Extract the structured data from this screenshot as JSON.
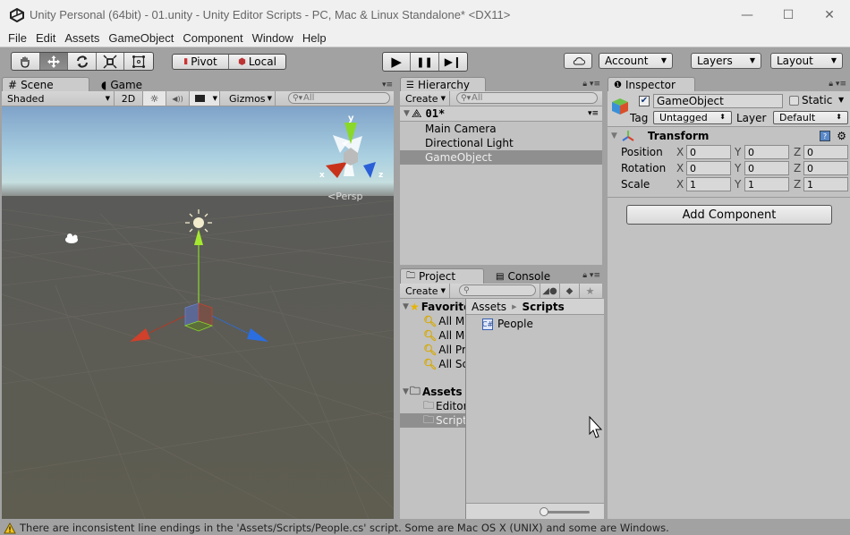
{
  "window": {
    "title": "Unity Personal (64bit) - 01.unity - Unity Editor Scripts - PC, Mac & Linux Standalone* <DX11>",
    "controls": {
      "minimize": "—",
      "maximize": "☐",
      "close": "✕"
    }
  },
  "menu": [
    "File",
    "Edit",
    "Assets",
    "GameObject",
    "Component",
    "Window",
    "Help"
  ],
  "toolbar": {
    "transform_tools": [
      "hand-icon",
      "move-icon",
      "rotate-icon",
      "scale-icon",
      "rect-icon"
    ],
    "active_tool": "move-icon",
    "pivot_label": "Pivot",
    "local_label": "Local",
    "play": "▶",
    "pause": "❚❚",
    "step": "▶❙",
    "cloud": "☁",
    "account": "Account",
    "layers": "Layers",
    "layout": "Layout"
  },
  "scene": {
    "tabs": [
      {
        "label": "Scene",
        "icon": "#",
        "active": true
      },
      {
        "label": "Game",
        "icon": "◖",
        "active": false
      }
    ],
    "shading": "Shaded",
    "mode_2d": "2D",
    "lighting": "☼",
    "audio": "◀))",
    "gizmos": "Gizmos",
    "search_placeholder": "All",
    "persp_label": "Persp",
    "axis_labels": {
      "x": "x",
      "y": "y",
      "z": "z"
    }
  },
  "hierarchy": {
    "tab": "Hierarchy",
    "create": "Create",
    "search_placeholder": "All",
    "scene_name": "01*",
    "items": [
      {
        "label": "Main Camera",
        "selected": false
      },
      {
        "label": "Directional Light",
        "selected": false
      },
      {
        "label": "GameObject",
        "selected": true
      }
    ]
  },
  "project": {
    "tabs": [
      {
        "label": "Project",
        "active": true
      },
      {
        "label": "Console",
        "active": false
      }
    ],
    "create": "Create",
    "favorites_label": "Favorites",
    "favorites": [
      "All Materials",
      "All Models",
      "All Prefabs",
      "All Scripts"
    ],
    "assets_label": "Assets",
    "folders": [
      {
        "label": "Editor",
        "selected": false
      },
      {
        "label": "Scripts",
        "selected": true
      }
    ],
    "breadcrumb": [
      "Assets",
      "Scripts"
    ],
    "files": [
      {
        "label": "People",
        "type": "C#"
      }
    ],
    "zoom_slider": 0.0
  },
  "inspector": {
    "tab": "Inspector",
    "object_name": "GameObject",
    "active": true,
    "static_label": "Static",
    "static_checked": false,
    "tag_label": "Tag",
    "tag_value": "Untagged",
    "layer_label": "Layer",
    "layer_value": "Default",
    "component": "Transform",
    "rows": [
      {
        "label": "Position",
        "x": "0",
        "y": "0",
        "z": "0"
      },
      {
        "label": "Rotation",
        "x": "0",
        "y": "0",
        "z": "0"
      },
      {
        "label": "Scale",
        "x": "1",
        "y": "1",
        "z": "1"
      }
    ],
    "add_component": "Add Component"
  },
  "status": {
    "message": "There are inconsistent line endings in the 'Assets/Scripts/People.cs' script. Some are Mac OS X (UNIX) and some are Windows."
  },
  "colors": {
    "panel": "#c2c2c2",
    "selection": "#8f8f8f",
    "axis_x": "#d0402a",
    "axis_y": "#8ad82a",
    "axis_z": "#2a6ee0"
  }
}
